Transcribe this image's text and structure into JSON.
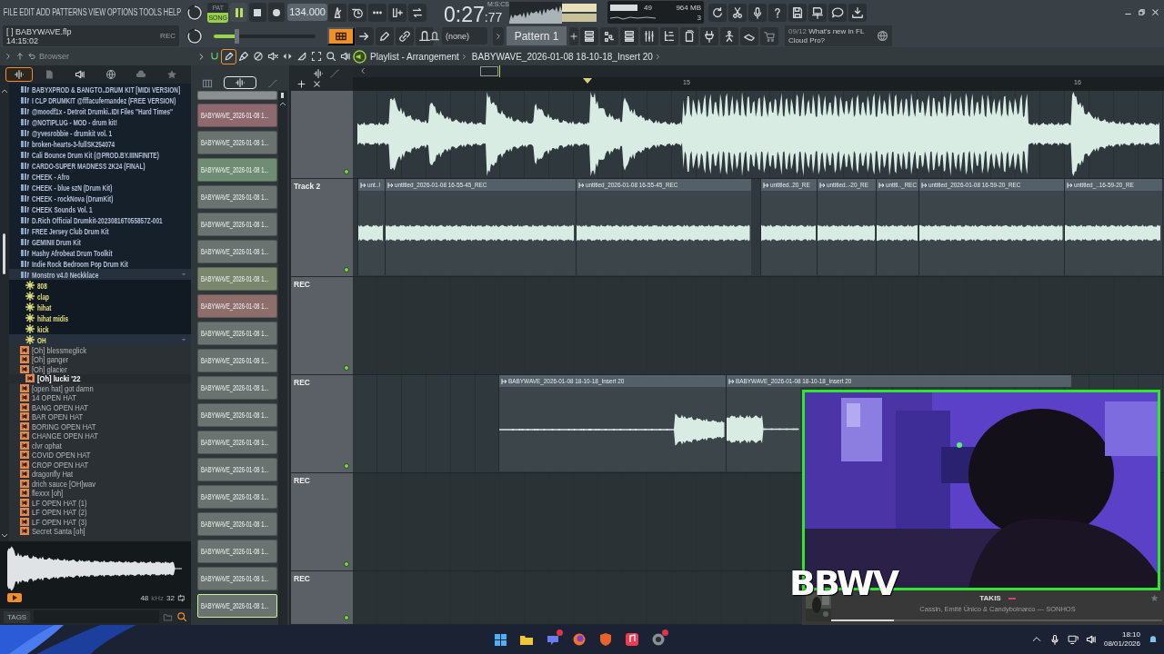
{
  "menu": [
    "FILE",
    "EDIT",
    "ADD",
    "PATTERNS",
    "VIEW",
    "OPTIONS",
    "TOOLS",
    "HELP"
  ],
  "project": {
    "marker": "[ ]",
    "file": "BABYWAVE.flp",
    "clock": "14:15:02",
    "rec": "REC"
  },
  "transport": {
    "modes": [
      {
        "label": "PAT",
        "selected": false
      },
      {
        "label": "SONG",
        "selected": true
      }
    ],
    "playing": true,
    "tempo": "134.000",
    "volume": {
      "level": 0.22
    }
  },
  "time": {
    "unit": "M:S:CS",
    "main": "0:27",
    "cs": ":77"
  },
  "performance": {
    "cpu": "49",
    "memory": "964 MB",
    "voices": "3"
  },
  "pattern": {
    "channel": "(none)",
    "name": "Pattern 1"
  },
  "news": {
    "date": "09/12",
    "text": "What's new in FL Cloud Pro?"
  },
  "browser": {
    "title": "Browser",
    "tabs": [
      {
        "selected": true
      },
      {
        "selected": false
      },
      {
        "selected": false
      },
      {
        "selected": false
      },
      {
        "selected": false
      },
      {
        "selected": false
      }
    ],
    "tree": [
      {
        "label": "BABYXPROD & BANGTO..DRUM KIT [MIDI VERSION]",
        "kind": "folder",
        "expanded": false
      },
      {
        "label": "I CLP DRUMKIT @fffacufernandez (FREE VERSION)",
        "kind": "folder",
        "expanded": false
      },
      {
        "label": "@moodf1x - Detroit Drumki..IDI Files \"Hard Times\"",
        "kind": "folder",
        "expanded": false
      },
      {
        "label": "@NOTIPLUG - MOD - drum kit!",
        "kind": "folder",
        "expanded": false
      },
      {
        "label": "@yvesrobbie - drumkit vol. 1",
        "kind": "folder",
        "expanded": false
      },
      {
        "label": "broken-hearts-3-fullSK254074",
        "kind": "folder",
        "expanded": false
      },
      {
        "label": "Cali Bounce Drum Kit (@PROD.BY.IIINFINITE)",
        "kind": "folder",
        "expanded": false
      },
      {
        "label": "CARDO-SUPER MADNESS 2K24 (FINAL)",
        "kind": "folder",
        "expanded": false
      },
      {
        "label": "CHEEK - Afro",
        "kind": "folder",
        "expanded": false
      },
      {
        "label": "CHEEK - blue szN (Drum Kit)",
        "kind": "folder",
        "expanded": false
      },
      {
        "label": "CHEEK - rockNova (DrumKit)",
        "kind": "folder",
        "expanded": false
      },
      {
        "label": "CHEEK Sounds Vol. 1",
        "kind": "folder",
        "expanded": false
      },
      {
        "label": "D.Rich Official Drumkit-20230816T055857Z-001",
        "kind": "folder",
        "expanded": false
      },
      {
        "label": "FREE Jersey Club Drum Kit",
        "kind": "folder",
        "expanded": false
      },
      {
        "label": "GEMINII Drum Kit",
        "kind": "folder",
        "expanded": false
      },
      {
        "label": "Hashy Afrobeat Drum Toolkit",
        "kind": "folder",
        "expanded": false
      },
      {
        "label": "Indie Rock Bedroom Pop Drum Kit",
        "kind": "folder",
        "expanded": false
      },
      {
        "label": "Monstro v4.0 Neckklace",
        "kind": "folder",
        "expanded": true,
        "children": [
          {
            "label": "808",
            "kind": "pack",
            "expanded": false
          },
          {
            "label": "clap",
            "kind": "pack",
            "expanded": false
          },
          {
            "label": "hihat",
            "kind": "pack",
            "expanded": false
          },
          {
            "label": "hihat midis",
            "kind": "pack",
            "expanded": false
          },
          {
            "label": "kick",
            "kind": "pack",
            "expanded": false
          },
          {
            "label": "OH",
            "kind": "pack",
            "expanded": true,
            "children": [
              {
                "label": "[Oh] blessmeglick",
                "kind": "file",
                "selected": false
              },
              {
                "label": "[Oh] ganger",
                "kind": "file",
                "selected": false
              },
              {
                "label": "[Oh] glacier",
                "kind": "file",
                "selected": false
              },
              {
                "label": "[Oh] lucki '22",
                "kind": "file",
                "selected": true
              },
              {
                "label": "[open hat] got damn",
                "kind": "file",
                "selected": false
              },
              {
                "label": "14 OPEN HAT",
                "kind": "file",
                "selected": false
              },
              {
                "label": "BANG OPEN HAT",
                "kind": "file",
                "selected": false
              },
              {
                "label": "BAR OPEN HAT",
                "kind": "file",
                "selected": false
              },
              {
                "label": "BORING OPEN HAT",
                "kind": "file",
                "selected": false
              },
              {
                "label": "CHANGE OPEN HAT",
                "kind": "file",
                "selected": false
              },
              {
                "label": "clvr ophat",
                "kind": "file",
                "selected": false
              },
              {
                "label": "COVID OPEN HAT",
                "kind": "file",
                "selected": false
              },
              {
                "label": "CROP OPEN HAT",
                "kind": "file",
                "selected": false
              },
              {
                "label": "dragonfly Hat",
                "kind": "file",
                "selected": false
              },
              {
                "label": "drich sauce [OH]wav",
                "kind": "file",
                "selected": false
              },
              {
                "label": "flexxx [oh]",
                "kind": "file",
                "selected": false
              },
              {
                "label": "LF OPEN HAT (1)",
                "kind": "file",
                "selected": false
              },
              {
                "label": "LF OPEN HAT (2)",
                "kind": "file",
                "selected": false
              },
              {
                "label": "LF OPEN HAT (3)",
                "kind": "file",
                "selected": false
              },
              {
                "label": "Secret Santa [oh]",
                "kind": "file",
                "selected": false
              }
            ]
          }
        ]
      }
    ],
    "sample": {
      "rate": "48",
      "unit": "kHz",
      "bits": "32"
    },
    "tags": "TAGS"
  },
  "playlist": {
    "title": "Playlist - Arrangement",
    "clip": "BABYWAVE_2026-01-08 18-10-18_Insert 20",
    "ruler": [
      "15",
      "16"
    ],
    "patterns": [
      {
        "color": "#8a8f91",
        "selected": false
      },
      {
        "label": "BABYWAVE_2026-01-08 1...",
        "color": "#8e6a70",
        "selected": false
      },
      {
        "label": "BABYWAVE_2026-01-08 1...",
        "color": "#6b7371",
        "selected": false
      },
      {
        "label": "BABYWAVE_2026-01-08 1...",
        "color": "#6f8d73",
        "selected": false
      },
      {
        "label": "BABYWAVE_2026-01-08 1...",
        "color": "#6b7371",
        "selected": false
      },
      {
        "label": "BABYWAVE_2026-01-08 1...",
        "color": "#6b7371",
        "selected": false
      },
      {
        "label": "BABYWAVE_2026-01-08 1...",
        "color": "#6b7371",
        "selected": false
      },
      {
        "label": "BABYWAVE_2026-01-08 1...",
        "color": "#7b876c",
        "selected": false
      },
      {
        "label": "BABYWAVE_2026-01-08 1...",
        "color": "#8d6e6a",
        "selected": false
      },
      {
        "label": "BABYWAVE_2026-01-08 1...",
        "color": "#6b7371",
        "selected": false
      },
      {
        "label": "BABYWAVE_2026-01-08 1...",
        "color": "#6b7371",
        "selected": false
      },
      {
        "label": "BABYWAVE_2026-01-08 1...",
        "color": "#6b7371",
        "selected": false
      },
      {
        "label": "BABYWAVE_2026-01-08 1...",
        "color": "#6b7371",
        "selected": false
      },
      {
        "label": "BABYWAVE_2026-01-08 1...",
        "color": "#6b7371",
        "selected": false
      },
      {
        "label": "BABYWAVE_2026-01-08 1...",
        "color": "#6b7371",
        "selected": false
      },
      {
        "label": "BABYWAVE_2026-01-08 1...",
        "color": "#6b7371",
        "selected": false
      },
      {
        "label": "BABYWAVE_2026-01-08 1...",
        "color": "#6b7371",
        "selected": false
      },
      {
        "label": "BABYWAVE_2026-01-08 1...",
        "color": "#6b7371",
        "selected": false
      },
      {
        "label": "BABYWAVE_2026-01-08 1...",
        "color": "#6b7371",
        "selected": false
      },
      {
        "label": "BABYWAVE_2026-01-08 1...",
        "color": "#6b7371",
        "selected": true
      }
    ],
    "tracks": [
      {
        "clips": [
          {
            "kind": "audio"
          }
        ]
      },
      {
        "name": "Track 2",
        "clips": [
          {
            "kind": "audio",
            "title": "unt..l"
          },
          {
            "kind": "audio",
            "title": "untitled_2026-01-08 16-55-45_REC"
          },
          {
            "kind": "audio",
            "title": "untitled_2026-01-08 16-55-45_REC"
          },
          {
            "kind": "audio",
            "title": "untitled..20_RE"
          },
          {
            "kind": "audio",
            "title": "untitled..-20_RE"
          },
          {
            "kind": "audio",
            "title": "untitl.._REC"
          },
          {
            "kind": "audio",
            "title": "untitled_2026-01-08 16-59-20_REC"
          },
          {
            "kind": "audio",
            "title": "untitled_..16-59-20_RE"
          }
        ]
      },
      {
        "name": "REC"
      },
      {
        "name": "REC",
        "clips": [
          {
            "kind": "audio",
            "title": "BABYWAVE_2026-01-08 18-10-18_Insert 20"
          },
          {
            "kind": "audio",
            "title": "BABYWAVE_2026-01-08 18-10-18_Insert 20"
          }
        ]
      },
      {
        "name": "REC"
      },
      {
        "name": "REC"
      }
    ]
  },
  "overlay": {
    "logo": "BBWV",
    "now_playing": {
      "title": "TAKIS",
      "artist": "Cassin, Emitê Único & Candyboinarco — SONHOS",
      "level": 0.19
    }
  },
  "taskbar": {
    "time": "18:10",
    "date": "08/01/2026"
  }
}
